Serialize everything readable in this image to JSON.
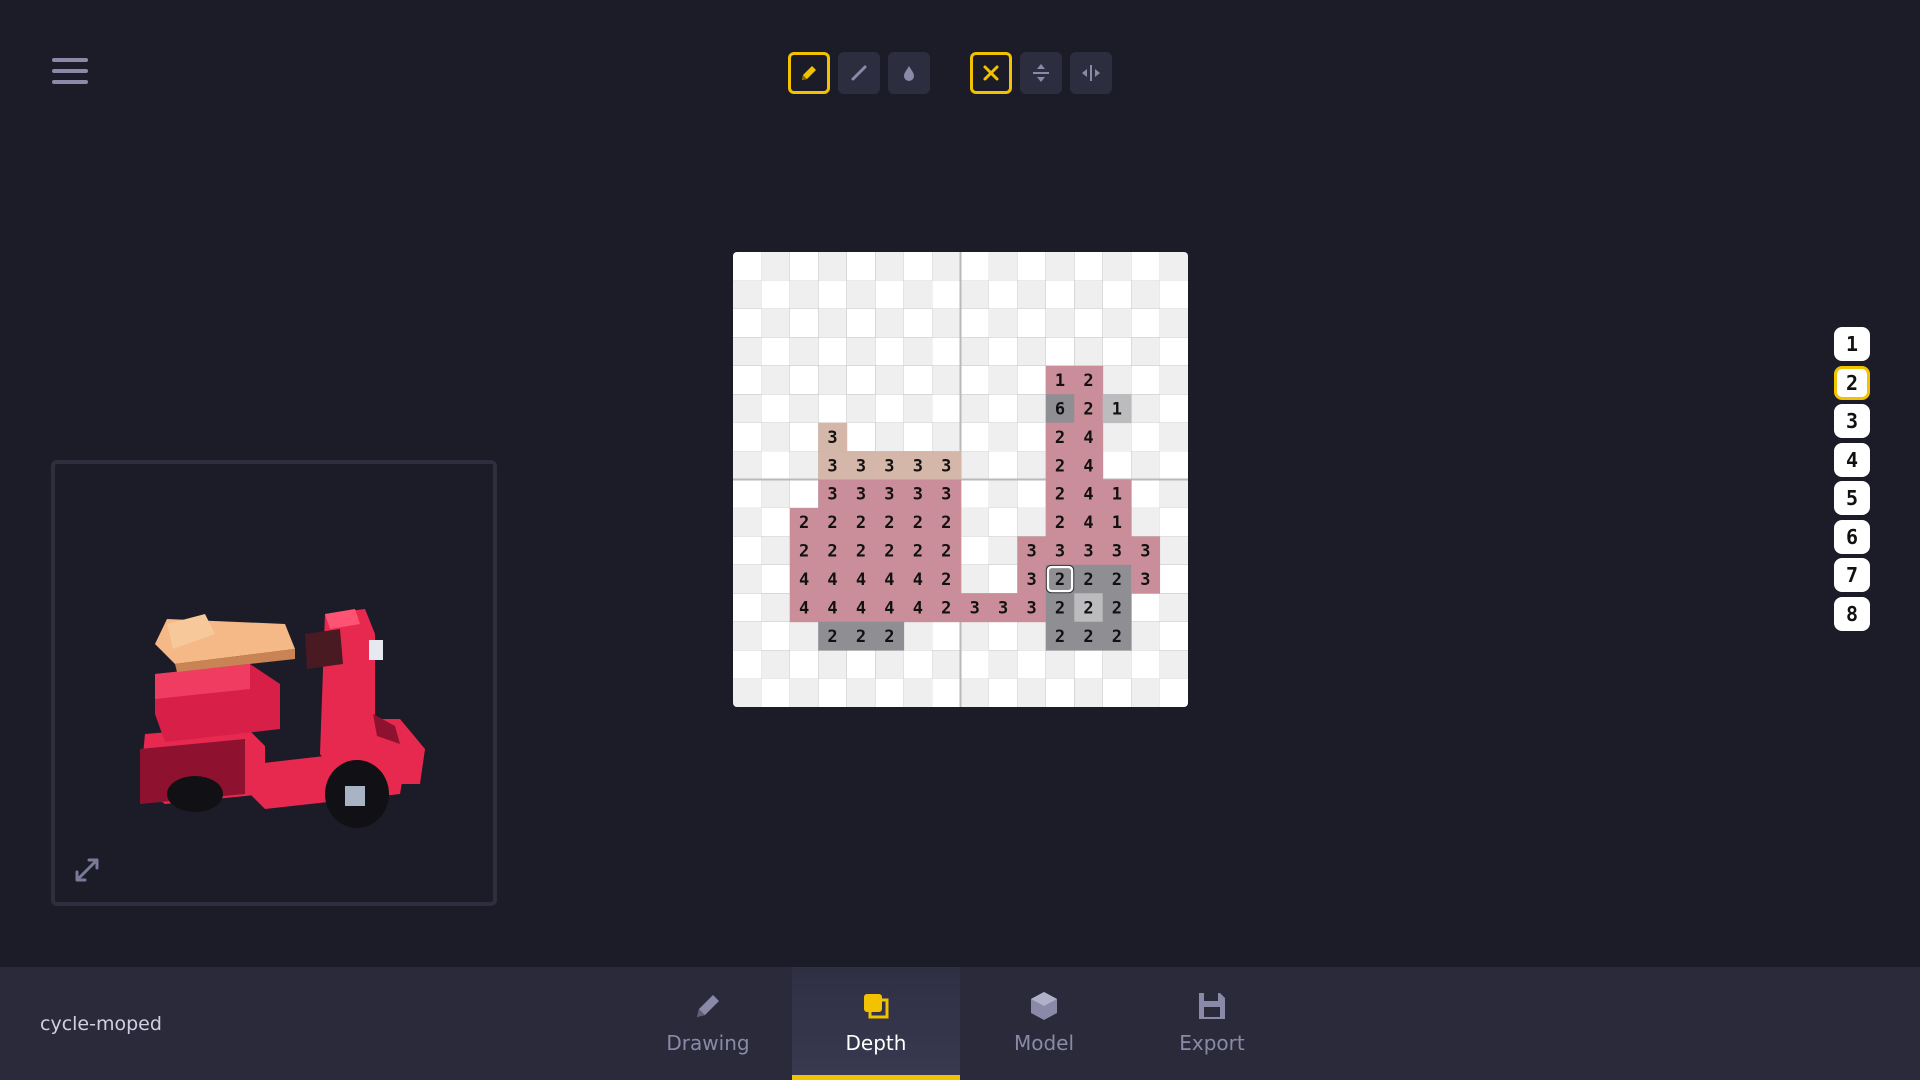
{
  "toolbar": {
    "draw_tools": [
      {
        "icon": "pencil-icon",
        "active": true
      },
      {
        "icon": "line-icon",
        "active": false
      },
      {
        "icon": "fill-drop-icon",
        "active": false
      }
    ],
    "mirror_tools": [
      {
        "icon": "mirror-off-icon",
        "active": true
      },
      {
        "icon": "mirror-horizontal-icon",
        "active": false
      },
      {
        "icon": "mirror-vertical-icon",
        "active": false
      }
    ]
  },
  "depth_levels": [
    "1",
    "2",
    "3",
    "4",
    "5",
    "6",
    "7",
    "8"
  ],
  "selected_depth": "2",
  "grid": {
    "size": 16,
    "selected_cell": [
      11,
      11
    ],
    "cells": [
      [
        11,
        4,
        "1",
        "p"
      ],
      [
        12,
        4,
        "2",
        "p"
      ],
      [
        11,
        5,
        "6",
        "g"
      ],
      [
        12,
        5,
        "2",
        "p"
      ],
      [
        13,
        5,
        "1",
        "lg"
      ],
      [
        11,
        6,
        "2",
        "p"
      ],
      [
        12,
        6,
        "4",
        "p"
      ],
      [
        3,
        6,
        "3",
        "t"
      ],
      [
        3,
        7,
        "3",
        "t"
      ],
      [
        4,
        7,
        "3",
        "t"
      ],
      [
        5,
        7,
        "3",
        "t"
      ],
      [
        6,
        7,
        "3",
        "t"
      ],
      [
        7,
        7,
        "3",
        "t"
      ],
      [
        11,
        7,
        "2",
        "p"
      ],
      [
        12,
        7,
        "4",
        "p"
      ],
      [
        3,
        8,
        "3",
        "p"
      ],
      [
        4,
        8,
        "3",
        "p"
      ],
      [
        5,
        8,
        "3",
        "p"
      ],
      [
        6,
        8,
        "3",
        "p"
      ],
      [
        7,
        8,
        "3",
        "p"
      ],
      [
        11,
        8,
        "2",
        "p"
      ],
      [
        12,
        8,
        "4",
        "p"
      ],
      [
        13,
        8,
        "1",
        "p"
      ],
      [
        2,
        9,
        "2",
        "p"
      ],
      [
        3,
        9,
        "2",
        "p"
      ],
      [
        4,
        9,
        "2",
        "p"
      ],
      [
        5,
        9,
        "2",
        "p"
      ],
      [
        6,
        9,
        "2",
        "p"
      ],
      [
        7,
        9,
        "2",
        "p"
      ],
      [
        11,
        9,
        "2",
        "p"
      ],
      [
        12,
        9,
        "4",
        "p"
      ],
      [
        13,
        9,
        "1",
        "p"
      ],
      [
        2,
        10,
        "2",
        "p"
      ],
      [
        3,
        10,
        "2",
        "p"
      ],
      [
        4,
        10,
        "2",
        "p"
      ],
      [
        5,
        10,
        "2",
        "p"
      ],
      [
        6,
        10,
        "2",
        "p"
      ],
      [
        7,
        10,
        "2",
        "p"
      ],
      [
        10,
        10,
        "3",
        "p"
      ],
      [
        11,
        10,
        "3",
        "p"
      ],
      [
        12,
        10,
        "3",
        "p"
      ],
      [
        13,
        10,
        "3",
        "p"
      ],
      [
        14,
        10,
        "3",
        "p"
      ],
      [
        2,
        11,
        "4",
        "p"
      ],
      [
        3,
        11,
        "4",
        "p"
      ],
      [
        4,
        11,
        "4",
        "p"
      ],
      [
        5,
        11,
        "4",
        "p"
      ],
      [
        6,
        11,
        "4",
        "p"
      ],
      [
        7,
        11,
        "2",
        "p"
      ],
      [
        10,
        11,
        "3",
        "p"
      ],
      [
        11,
        11,
        "2",
        "g"
      ],
      [
        12,
        11,
        "2",
        "g"
      ],
      [
        13,
        11,
        "2",
        "g"
      ],
      [
        14,
        11,
        "3",
        "p"
      ],
      [
        2,
        12,
        "4",
        "p"
      ],
      [
        3,
        12,
        "4",
        "p"
      ],
      [
        4,
        12,
        "4",
        "p"
      ],
      [
        5,
        12,
        "4",
        "p"
      ],
      [
        6,
        12,
        "4",
        "p"
      ],
      [
        7,
        12,
        "2",
        "p"
      ],
      [
        8,
        12,
        "3",
        "p"
      ],
      [
        9,
        12,
        "3",
        "p"
      ],
      [
        10,
        12,
        "3",
        "p"
      ],
      [
        11,
        12,
        "2",
        "g"
      ],
      [
        12,
        12,
        "2",
        "lg"
      ],
      [
        13,
        12,
        "2",
        "g"
      ],
      [
        3,
        13,
        "2",
        "g"
      ],
      [
        4,
        13,
        "2",
        "g"
      ],
      [
        5,
        13,
        "2",
        "g"
      ],
      [
        11,
        13,
        "2",
        "g"
      ],
      [
        12,
        13,
        "2",
        "g"
      ],
      [
        13,
        13,
        "2",
        "g"
      ]
    ]
  },
  "file": {
    "name": "cycle-moped"
  },
  "tabs": [
    {
      "label": "Drawing",
      "icon": "pencil-icon",
      "active": false
    },
    {
      "label": "Depth",
      "icon": "depth-layers-icon",
      "active": true
    },
    {
      "label": "Model",
      "icon": "cube-icon",
      "active": false
    },
    {
      "label": "Export",
      "icon": "save-icon",
      "active": false
    }
  ],
  "colors": {
    "accent": "#f2c200",
    "background": "#1c1c28",
    "panel": "#2a2a3a",
    "cell_pink": "#c98e9a",
    "cell_tan": "#d4b7a9",
    "cell_gray": "#8f8f93",
    "cell_lightgray": "#bcbcbf"
  }
}
